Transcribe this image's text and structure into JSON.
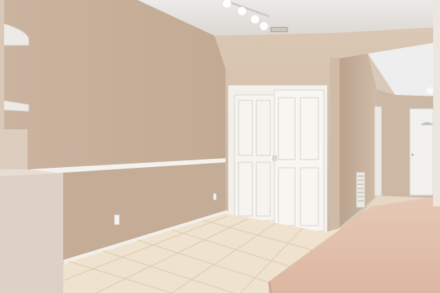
{
  "scene": {
    "description_tags": [
      "room",
      "closet",
      "hallway",
      "tile-floor"
    ],
    "colors": {
      "wall": "#c9b39e",
      "wall_light": "#d9c6b3",
      "ceiling": "#e8e6e3",
      "trim": "#f4f2ee",
      "floor_tile": "#efe3cf",
      "grout": "#d9cbb4",
      "counter": "#e3c3b0",
      "door": "#f3f1ed"
    }
  }
}
